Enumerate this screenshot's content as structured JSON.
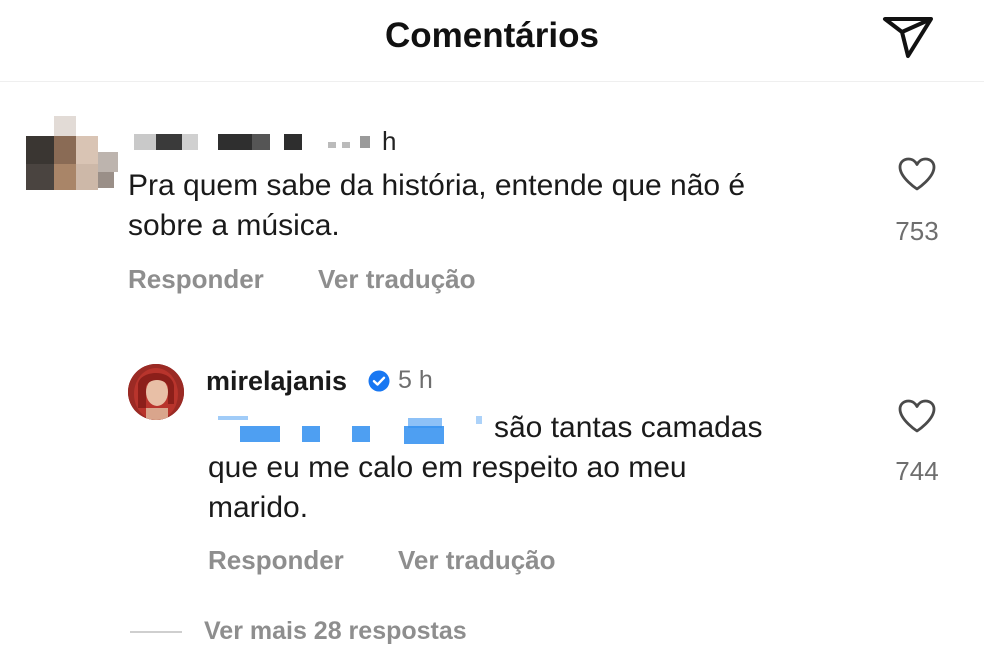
{
  "header": {
    "title": "Comentários",
    "icons": {
      "send": "paper-plane-icon"
    }
  },
  "comments": [
    {
      "time": "h",
      "text_line1": "Pra quem sabe da história, entende que não é",
      "text_line2": "sobre a música.",
      "likes": "753",
      "reply_label": "Responder",
      "translate_label": "Ver tradução"
    }
  ],
  "reply": {
    "username": "mirelajanis",
    "time": "5 h",
    "text_line1": "são tantas camadas",
    "text_line2": "que eu me calo em respeito ao meu",
    "text_line3": "marido.",
    "likes": "744",
    "reply_label": "Responder",
    "translate_label": "Ver tradução"
  },
  "view_more": "Ver mais 28 respostas",
  "colors": {
    "text": "#1a1a1a",
    "muted": "#8e8e8e",
    "verified": "#1877f2",
    "mention_blur": "#2f8ef0"
  }
}
